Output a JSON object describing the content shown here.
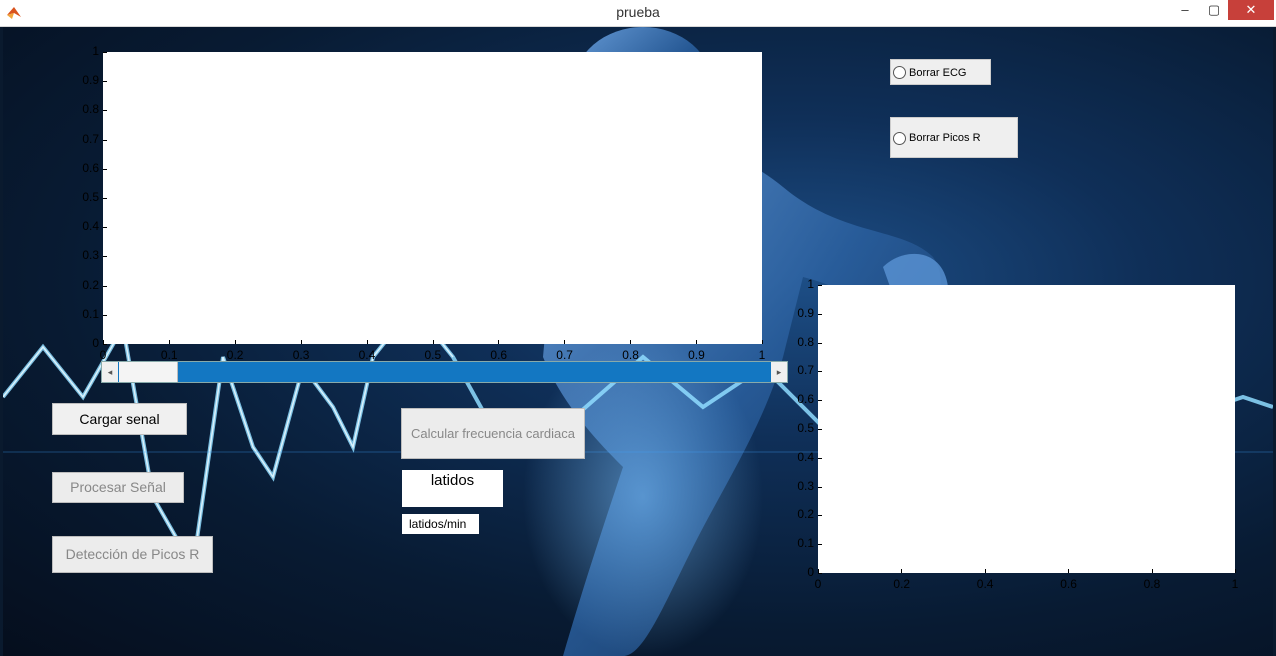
{
  "window": {
    "title": "prueba",
    "minimize_label": "–",
    "maximize_label": "▢",
    "close_label": "✕"
  },
  "top_axes": {
    "x_ticks": [
      "0",
      "0.1",
      "0.2",
      "0.3",
      "0.4",
      "0.5",
      "0.6",
      "0.7",
      "0.8",
      "0.9",
      "1"
    ],
    "y_ticks": [
      "0",
      "0.1",
      "0.2",
      "0.3",
      "0.4",
      "0.5",
      "0.6",
      "0.7",
      "0.8",
      "0.9",
      "1"
    ]
  },
  "bottom_axes": {
    "x_ticks": [
      "0",
      "0.2",
      "0.4",
      "0.6",
      "0.8",
      "1"
    ],
    "y_ticks": [
      "0",
      "0.1",
      "0.2",
      "0.3",
      "0.4",
      "0.5",
      "0.6",
      "0.7",
      "0.8",
      "0.9",
      "1"
    ]
  },
  "scrollbar": {
    "position": 0.0,
    "left_arrow": "◂",
    "right_arrow": "▸"
  },
  "buttons": {
    "cargar": "Cargar senal",
    "procesar": "Procesar Señal",
    "deteccion": "Detección de Picos R",
    "calcular": "Calcular frecuencia cardiaca"
  },
  "fields": {
    "latidos_value": "latidos",
    "latidos_unit": "latidos/min"
  },
  "radios": {
    "borrar_ecg": "Borrar ECG",
    "borrar_picos": "Borrar Picos R"
  },
  "colors": {
    "scroll_accent": "#1377c2",
    "close_button": "#c7403a"
  }
}
